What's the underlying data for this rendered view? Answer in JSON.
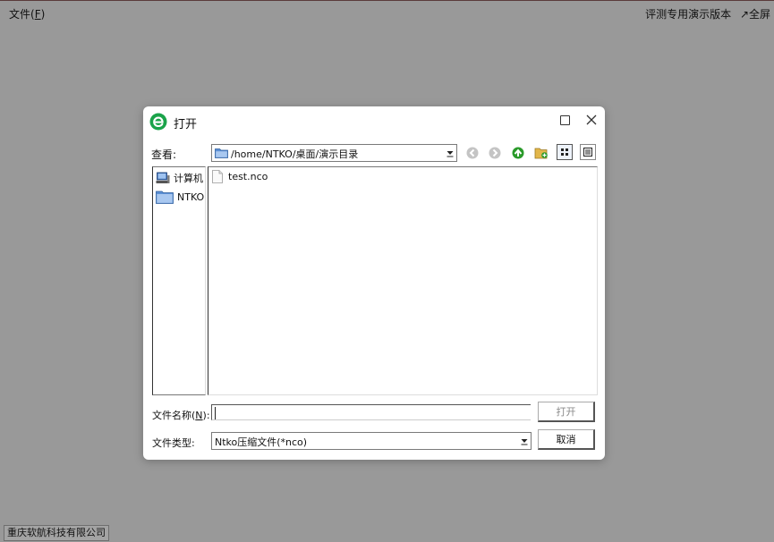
{
  "app": {
    "menu_file": "文件",
    "menu_file_key": "F",
    "eval_label": "评测专用演示版本",
    "fullscreen_label": "↗全屏",
    "company": "重庆软航科技有限公司"
  },
  "dialog": {
    "title": "打开",
    "look_in_label": "查看:",
    "look_in_path": "/home/NTKO/桌面/演示目录",
    "sidebar": [
      {
        "label": "计算机",
        "icon": "computer-icon"
      },
      {
        "label": "NTKO",
        "icon": "folder-icon"
      }
    ],
    "files": [
      {
        "name": "test.nco",
        "icon": "file-icon"
      }
    ],
    "filename_label_prefix": "文件名称(",
    "filename_label_key": "N",
    "filename_label_suffix": "):",
    "filename_value": "",
    "filetype_label": "文件类型:",
    "filetype_value": "Ntko压缩文件(*nco)",
    "open_button": "打开",
    "cancel_button": "取消"
  },
  "colors": {
    "background": "#999999",
    "logo_green": "#1aa34a",
    "up_arrow_green": "#2a9a2a",
    "folder_blue": "#5b8fd4"
  }
}
